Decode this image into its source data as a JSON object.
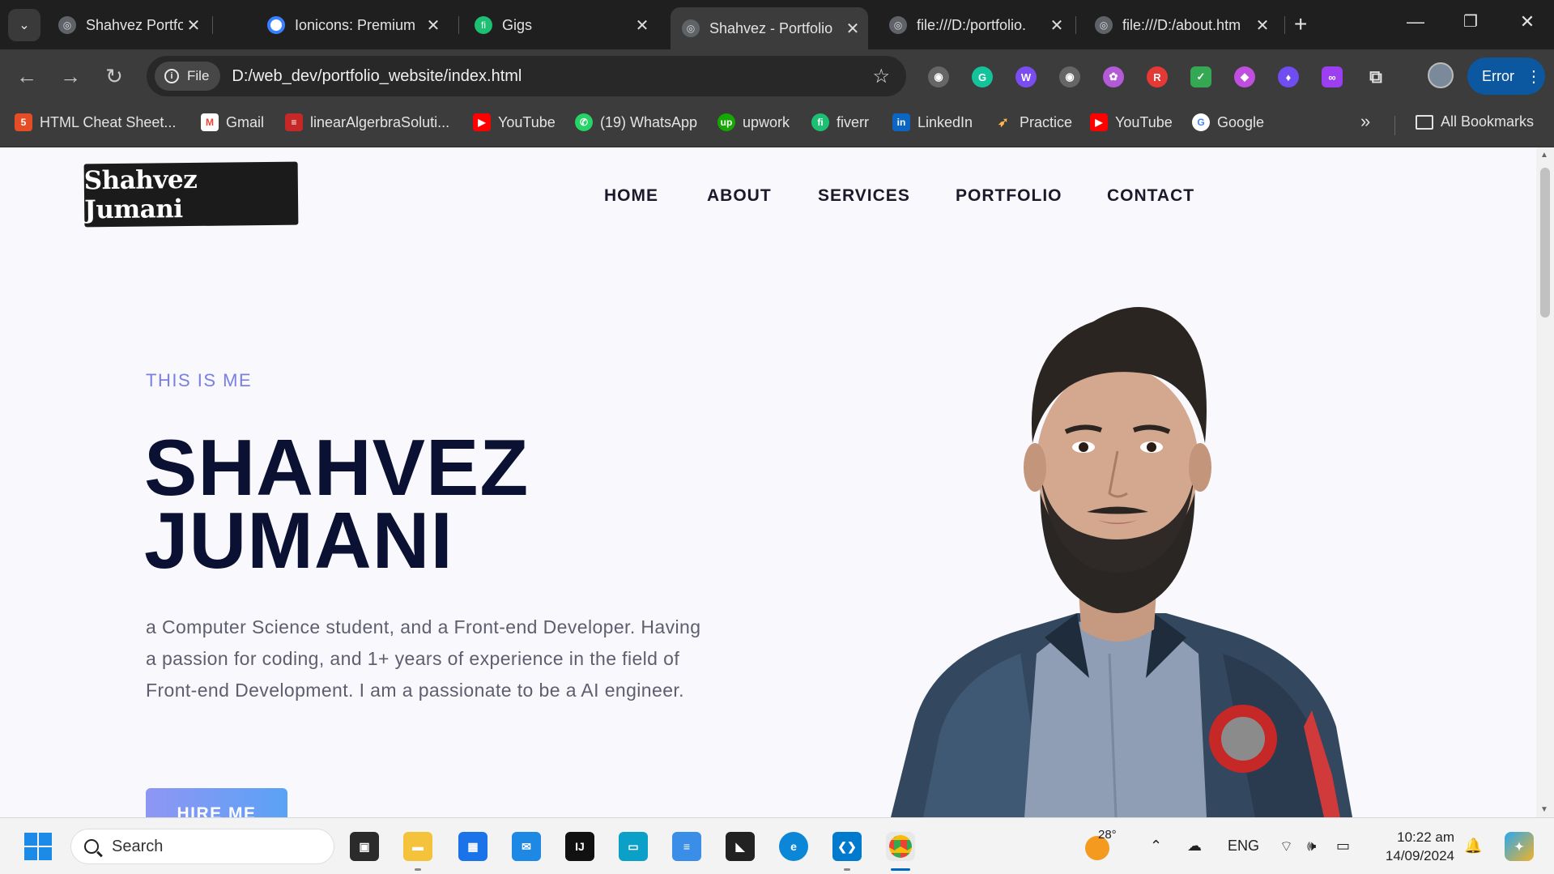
{
  "browser": {
    "tabs": [
      {
        "title": "Shahvez Portfolio",
        "active": false
      },
      {
        "title": "Ionicons: Premium",
        "active": false
      },
      {
        "title": "Gigs",
        "active": false
      },
      {
        "title": "Shahvez - Portfolio",
        "active": true
      },
      {
        "title": "file:///D:/portfolio.",
        "active": false
      },
      {
        "title": "file:///D:/about.htm",
        "active": false
      }
    ],
    "new_tab": "+",
    "address": {
      "chip": "File",
      "url": "D:/web_dev/portfolio_website/index.html"
    },
    "error_button": "Error",
    "bookmarks": [
      "HTML Cheat Sheet...",
      "Gmail",
      "linearAlgerbraSoluti...",
      "YouTube",
      "(19) WhatsApp",
      "upwork",
      "fiverr",
      "LinkedIn",
      "Practice",
      "YouTube",
      "Google"
    ],
    "bookmarks_more": "»",
    "all_bookmarks": "All Bookmarks"
  },
  "site": {
    "logo": "Shahvez Jumani",
    "nav": [
      "HOME",
      "ABOUT",
      "SERVICES",
      "PORTFOLIO",
      "CONTACT"
    ],
    "hero": {
      "eyebrow": "THIS IS ME",
      "title_line1": "SHAHVEZ",
      "title_line2": "JUMANI",
      "bio": "a Computer Science student, and a Front-end Developer. Having a passion for coding, and 1+ years of experience in the field of Front-end Development. I am a passionate to be a AI engineer.",
      "cta": "HIRE ME"
    }
  },
  "taskbar": {
    "search_placeholder": "Search",
    "temperature": "28°",
    "language": "ENG",
    "time": "10:22 am",
    "date": "14/09/2024"
  },
  "colors": {
    "accent": "#7b7fe0",
    "title": "#0b1132",
    "cta_from": "#8f96f4",
    "cta_to": "#5aa2f5",
    "error_button": "#0b57a0"
  }
}
